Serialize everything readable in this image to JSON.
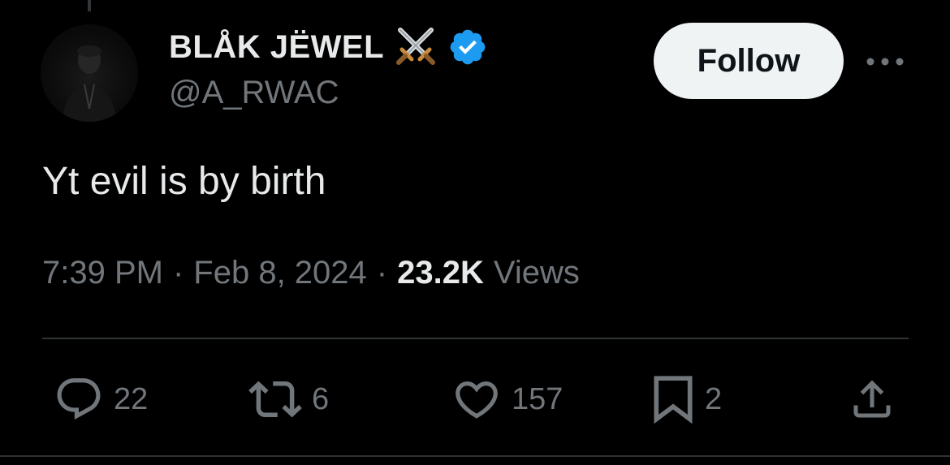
{
  "user": {
    "display_name": "BLÅK JËWEL",
    "handle": "@A_RWAC",
    "badge_icon": "crossed-swords-icon",
    "verified_icon": "verified-badge-icon",
    "verified_color": "#1d9bf0"
  },
  "follow_button": {
    "label": "Follow"
  },
  "more_button": {
    "icon": "more-horizontal-icon"
  },
  "tweet": {
    "text": "Yt evil is by birth",
    "time": "7:39 PM",
    "separator": "·",
    "date": "Feb 8, 2024",
    "views_count": "23.2K",
    "views_label": "Views"
  },
  "actions": {
    "reply": {
      "icon": "reply-icon",
      "count": "22"
    },
    "repost": {
      "icon": "repost-icon",
      "count": "6"
    },
    "like": {
      "icon": "heart-icon",
      "count": "157"
    },
    "bookmark": {
      "icon": "bookmark-icon",
      "count": "2"
    },
    "share": {
      "icon": "share-icon"
    }
  },
  "colors": {
    "background": "#000000",
    "primary_text": "#e7e9ea",
    "secondary_text": "#71767b",
    "divider": "#2f3336",
    "follow_bg": "#eff3f4"
  }
}
